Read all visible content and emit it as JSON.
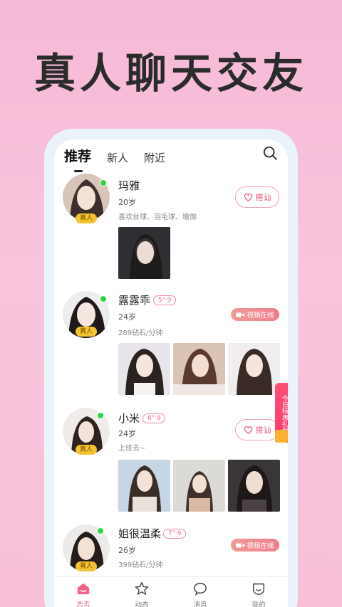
{
  "headline": "真人聊天交友",
  "tabs": [
    {
      "label": "推荐",
      "active": true
    },
    {
      "label": "新人",
      "active": false
    },
    {
      "label": "附近",
      "active": false
    }
  ],
  "real_badge": "真人",
  "profiles": [
    {
      "name": "玛雅",
      "age": "20岁",
      "desc": "喜欢台球、羽毛球、瑜伽",
      "action": "搭讪",
      "online": true
    },
    {
      "name": "露露乖",
      "chip": "5\"·9",
      "age": "24岁",
      "desc": "289钻石/分钟",
      "action": "视频在线",
      "online": true
    },
    {
      "name": "小米",
      "chip": "6\"·9",
      "age": "24岁",
      "desc": "上班去~",
      "action": "搭讪",
      "online": true
    },
    {
      "name": "姐很温柔",
      "chip": "7\"·9",
      "age": "26岁",
      "desc": "399钻石/分钟",
      "action": "视频在线",
      "online": true
    }
  ],
  "float_banner": "今日特惠礼包",
  "bottom_nav": [
    {
      "label": "恋否",
      "icon": "home-icon",
      "active": true
    },
    {
      "label": "动态",
      "icon": "star-icon",
      "active": false
    },
    {
      "label": "消息",
      "icon": "chat-bubble-icon",
      "active": false
    },
    {
      "label": "我的",
      "icon": "profile-icon",
      "active": false
    }
  ],
  "colors": {
    "accent": "#f0648b",
    "online": "#31d34a",
    "badge": "#f3c431",
    "bg": "#f7c0d7"
  }
}
